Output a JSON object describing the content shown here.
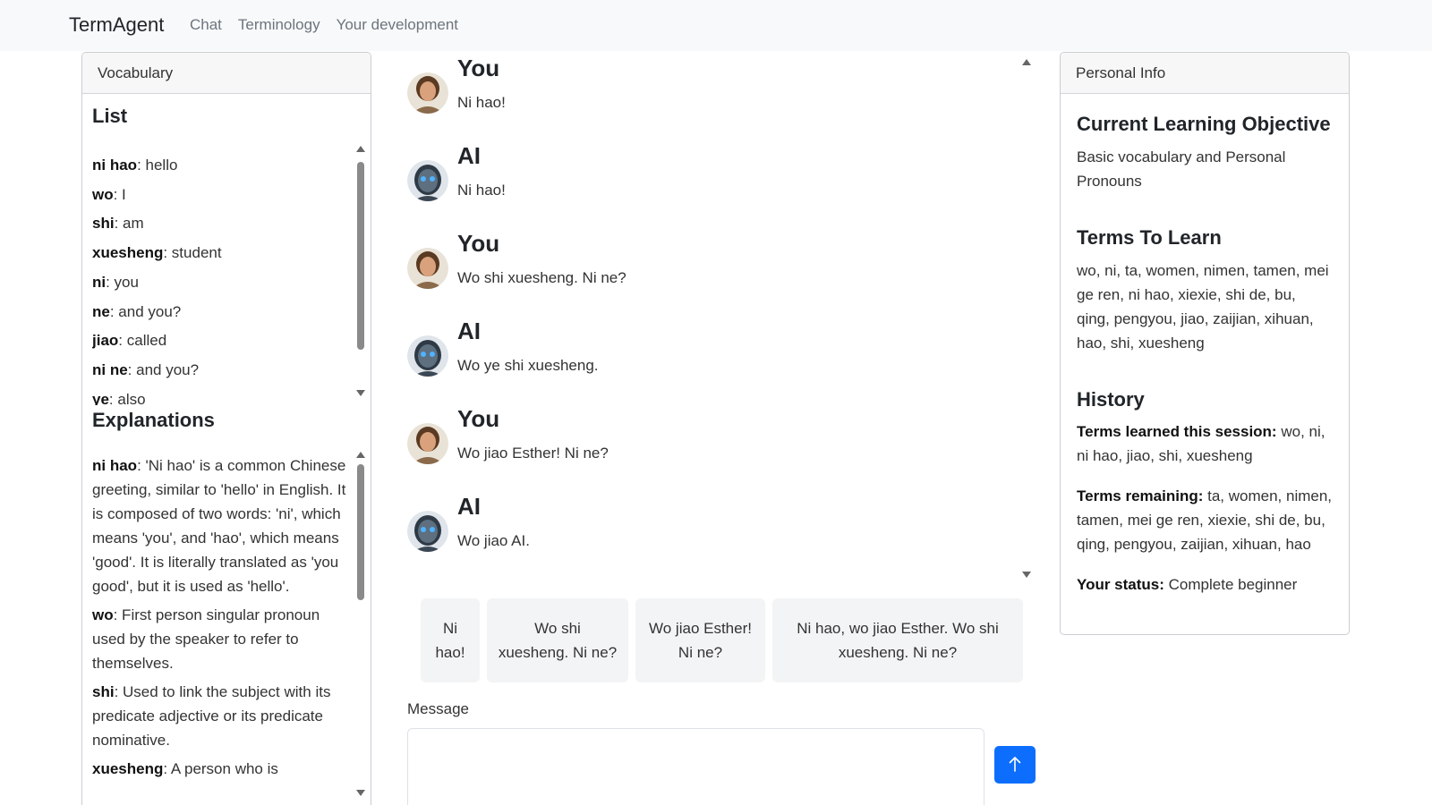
{
  "navbar": {
    "brand": "TermAgent",
    "links": [
      "Chat",
      "Terminology",
      "Your development"
    ]
  },
  "vocabulary": {
    "header": "Vocabulary",
    "list_title": "List",
    "list": [
      {
        "term": "ni hao",
        "meaning": ": hello"
      },
      {
        "term": "wo",
        "meaning": ": I"
      },
      {
        "term": "shi",
        "meaning": ": am"
      },
      {
        "term": "xuesheng",
        "meaning": ": student"
      },
      {
        "term": "ni",
        "meaning": ": you"
      },
      {
        "term": "ne",
        "meaning": ": and you?"
      },
      {
        "term": "jiao",
        "meaning": ": called"
      },
      {
        "term": "ni ne",
        "meaning": ": and you?"
      },
      {
        "term": "ye",
        "meaning": ": also"
      }
    ],
    "explanations_title": "Explanations",
    "explanations": [
      {
        "term": "ni hao",
        "text": ": 'Ni hao' is a common Chinese greeting, similar to 'hello' in English. It is composed of two words: 'ni', which means 'you', and 'hao', which means 'good'. It is literally translated as 'you good', but it is used as 'hello'."
      },
      {
        "term": "wo",
        "text": ": First person singular pronoun used by the speaker to refer to themselves."
      },
      {
        "term": "shi",
        "text": ": Used to link the subject with its predicate adjective or its predicate nominative."
      },
      {
        "term": "xuesheng",
        "text": ": A person who is"
      }
    ]
  },
  "chat": {
    "messages": [
      {
        "author": "You",
        "text": "Ni hao!",
        "avatar": "human-avatar-icon"
      },
      {
        "author": "AI",
        "text": "Ni hao!",
        "avatar": "robot-avatar-icon"
      },
      {
        "author": "You",
        "text": "Wo shi xuesheng. Ni ne?",
        "avatar": "human-avatar-icon"
      },
      {
        "author": "AI",
        "text": "Wo ye shi xuesheng.",
        "avatar": "robot-avatar-icon"
      },
      {
        "author": "You",
        "text": "Wo jiao Esther! Ni ne?",
        "avatar": "human-avatar-icon"
      },
      {
        "author": "AI",
        "text": "Wo jiao AI.",
        "avatar": "robot-avatar-icon"
      }
    ],
    "suggestions": [
      "Ni hao!",
      "Wo shi xuesheng. Ni ne?",
      "Wo jiao Esther! Ni ne?",
      "Ni hao, wo jiao Esther. Wo shi xuesheng. Ni ne?"
    ],
    "message_label": "Message",
    "message_value": "",
    "send_icon": "arrow-up-icon"
  },
  "personal_info": {
    "header": "Personal Info",
    "objective_title": "Current Learning Objective",
    "objective_text": "Basic vocabulary and Personal Pronouns",
    "terms_title": "Terms To Learn",
    "terms_text": "wo, ni, ta, women, nimen, tamen, mei ge ren, ni hao, xiexie, shi de, bu, qing, pengyou, jiao, zaijian, xihuan, hao, shi, xuesheng",
    "history_title": "History",
    "learned_label": "Terms learned this session:",
    "learned_value": " wo, ni, ni hao, jiao, shi, xuesheng",
    "remaining_label": "Terms remaining:",
    "remaining_value": " ta, women, nimen, tamen, mei ge ren, xiexie, shi de, bu, qing, pengyou, zaijian, xihuan, hao",
    "status_label": "Your status:",
    "status_value": " Complete beginner"
  },
  "colors": {
    "accent": "#0d6efd",
    "navbar_bg": "#f8f9fa",
    "suggestion_bg": "#f3f4f5"
  }
}
